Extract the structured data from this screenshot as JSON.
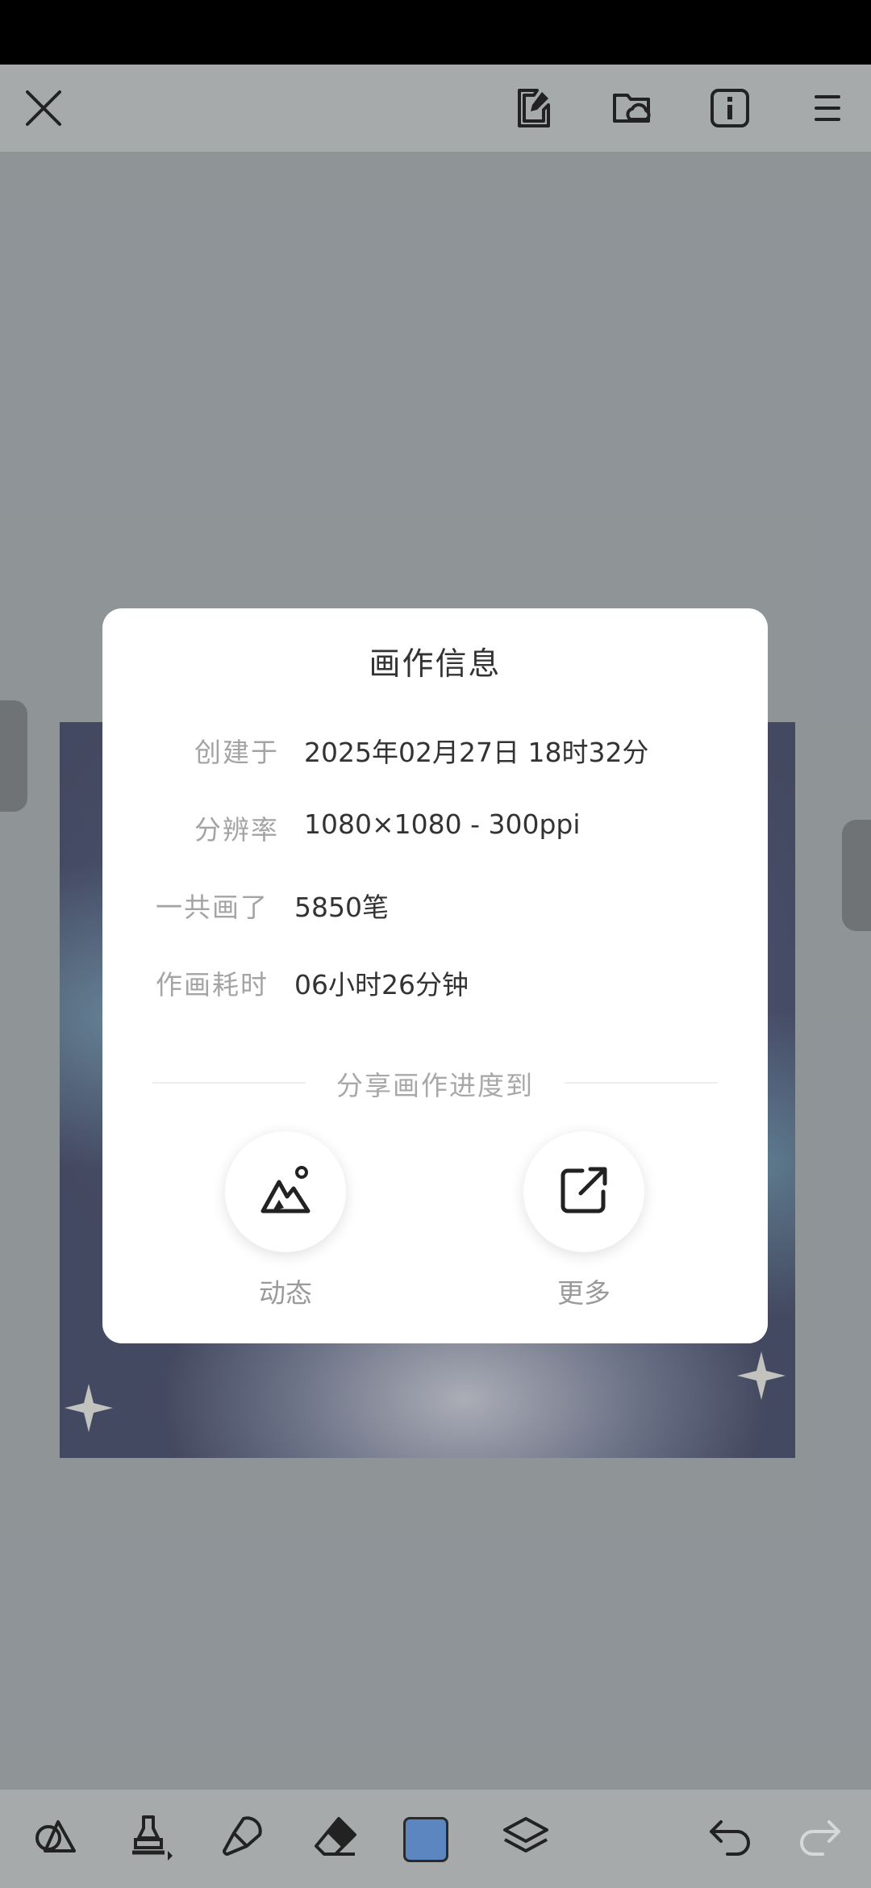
{
  "toolbar": {
    "icons": [
      "close-icon",
      "edit-note-icon",
      "cloud-folder-icon",
      "info-icon",
      "menu-icon"
    ]
  },
  "dialog": {
    "title": "画作信息",
    "rows": [
      {
        "label": "创建于",
        "value": "2025年02月27日 18时32分"
      },
      {
        "label": "分辨率",
        "value": "1080×1080 - 300ppi"
      },
      {
        "label": "一共画了",
        "value": "5850笔"
      },
      {
        "label": "作画耗时",
        "value": "06小时26分钟"
      }
    ],
    "share_title": "分享画作进度到",
    "share_buttons": [
      {
        "label": "动态",
        "icon": "mountain-image-icon"
      },
      {
        "label": "更多",
        "icon": "external-share-icon"
      }
    ]
  },
  "bottom_toolbar": {
    "icons": [
      "shapes-icon",
      "marker-icon",
      "brush-icon",
      "eraser-icon",
      "color-swatch",
      "layers-icon",
      "undo-icon",
      "redo-icon"
    ],
    "current_color": "#5b86c0"
  },
  "colors": {
    "toolbar_bg": "#a7aaab",
    "backdrop": "#9a9ea1",
    "dialog_bg": "#ffffff"
  }
}
